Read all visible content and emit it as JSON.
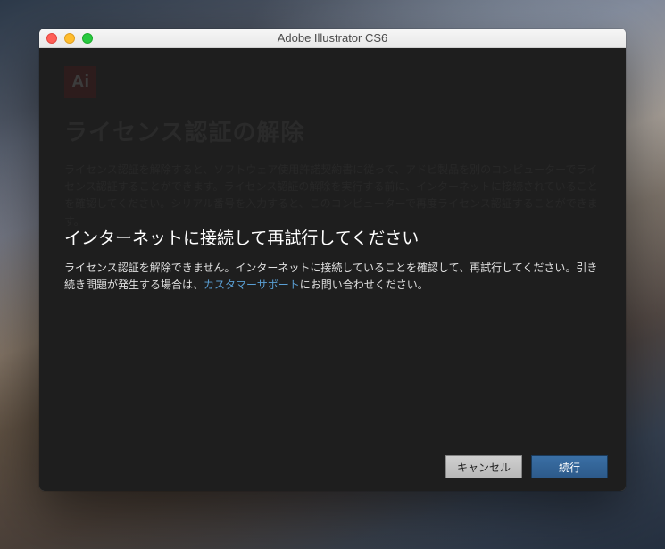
{
  "window": {
    "title": "Adobe Illustrator CS6"
  },
  "background": {
    "logo_text": "Ai",
    "heading": "ライセンス認証の解除",
    "body": "ライセンス認証を解除すると、ソフトウェア使用許諾契約書に従って、アドビ製品を別のコンピューターでライセンス認証することができます。ライセンス認証の解除を実行する前に、インターネットに接続されていることを確認してください。シリアル番号を入力すると、このコンピューターで再度ライセンス認証することができます。"
  },
  "error": {
    "title": "インターネットに接続して再試行してください",
    "body_before": "ライセンス認証を解除できません。インターネットに接続していることを確認して、再試行してください。引き続き問題が発生する場合は、",
    "link_text": "カスタマーサポート",
    "body_after": "にお問い合わせください。"
  },
  "buttons": {
    "cancel": "キャンセル",
    "continue": "続行"
  }
}
